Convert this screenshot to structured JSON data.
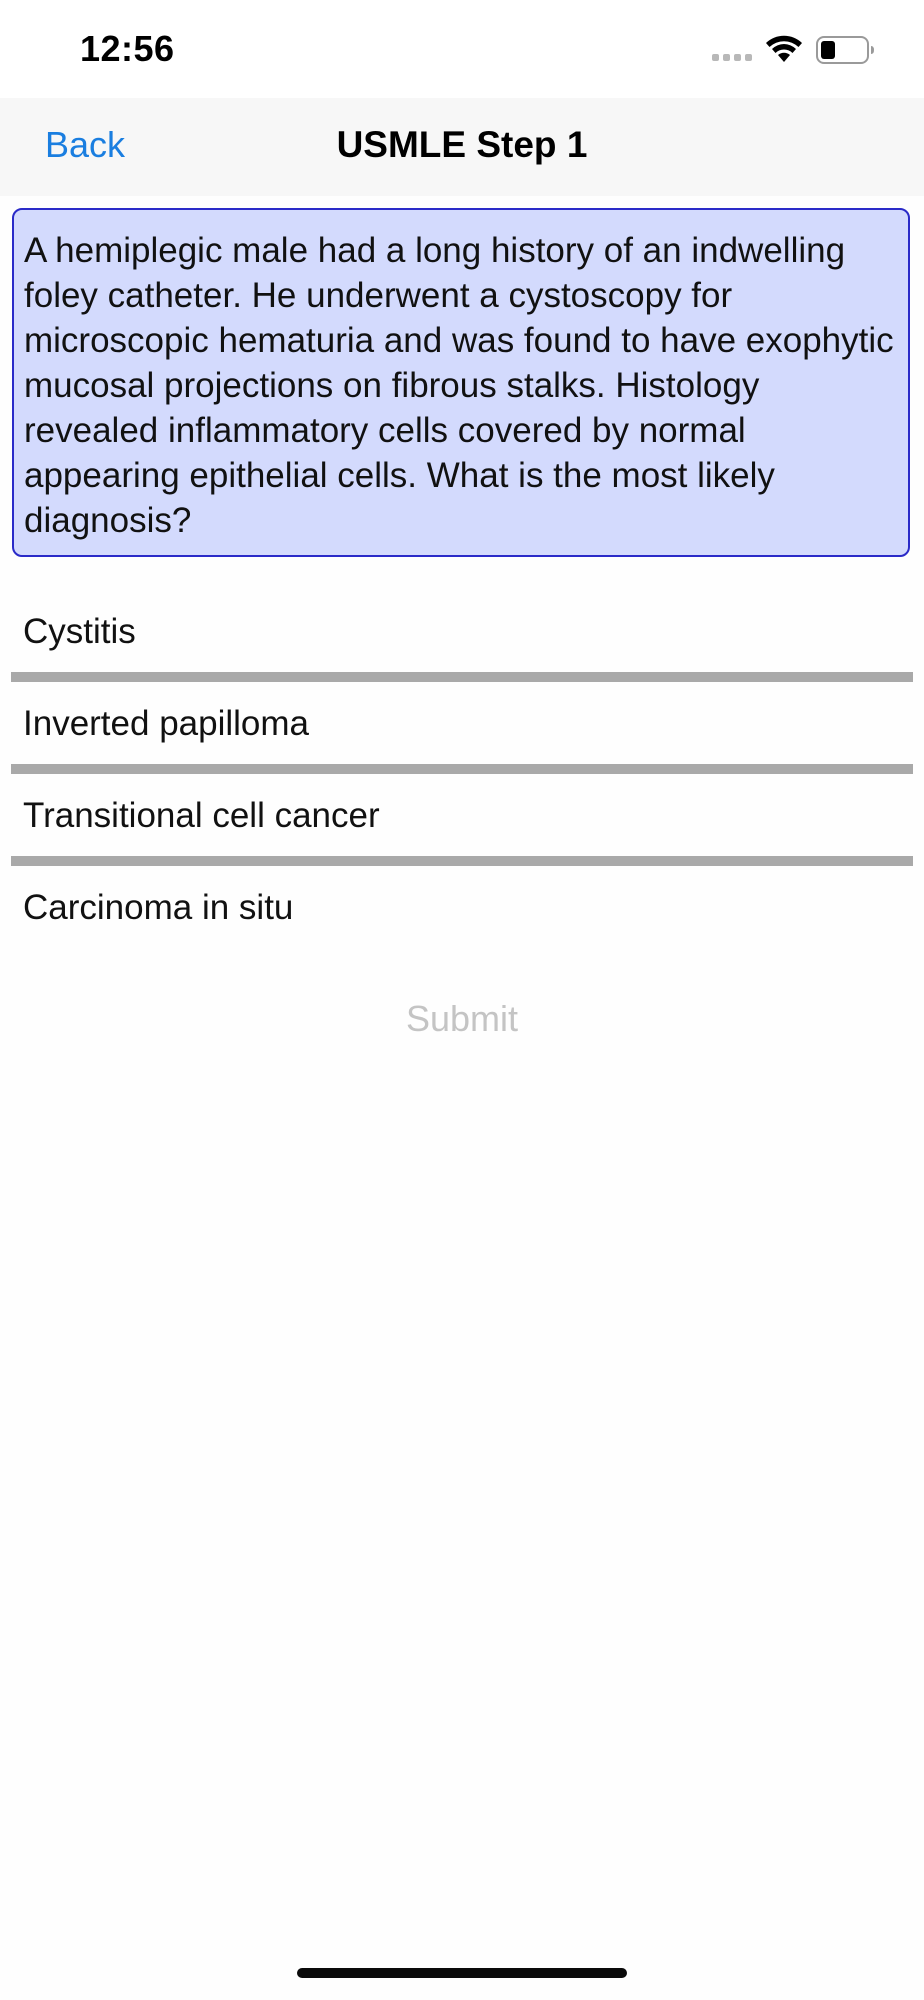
{
  "status_bar": {
    "time": "12:56",
    "icons": [
      "signal-dots-icon",
      "wifi-icon",
      "battery-icon"
    ]
  },
  "nav": {
    "back_label": "Back",
    "title": "USMLE Step 1"
  },
  "question": {
    "text": "A hemiplegic male had a long history of an indwelling foley catheter. He underwent a cystoscopy for microscopic hematuria and was found to have exophytic mucosal projections on fibrous stalks. Histology revealed inflammatory cells covered by normal appearing epithelial cells. What is the most likely diagnosis?"
  },
  "answers": [
    {
      "label": "Cystitis"
    },
    {
      "label": "Inverted papilloma"
    },
    {
      "label": "Transitional cell cancer"
    },
    {
      "label": "Carcinoma in situ"
    }
  ],
  "submit_label": "Submit",
  "colors": {
    "accent": "#1a7ee0",
    "question_bg": "#d3dafd",
    "question_border": "#2a2ac8",
    "divider": "#a9a9a9",
    "submit_disabled": "#c4c4c4"
  }
}
